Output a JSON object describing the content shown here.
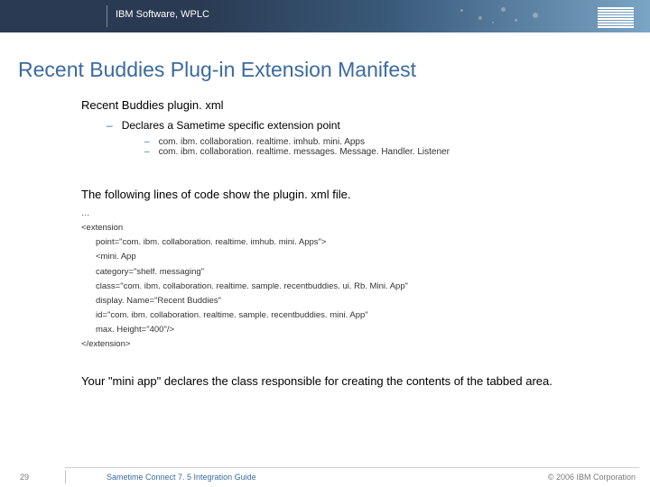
{
  "header": {
    "text": "IBM Software, WPLC",
    "logo_name": "ibm-logo"
  },
  "title": "Recent Buddies Plug-in Extension Manifest",
  "section1": {
    "heading": "Recent Buddies plugin. xml",
    "sub1": "Declares a Sametime specific extension point",
    "pt1": "com. ibm. collaboration. realtime. imhub. mini. Apps",
    "pt2": "com. ibm. collaboration. realtime. messages. Message. Handler. Listener"
  },
  "section2": {
    "heading": "The following lines of code show the plugin. xml file.",
    "code": {
      "l1": "…",
      "l2": "<extension",
      "l3": "point=\"com. ibm. collaboration. realtime. imhub. mini. Apps\">",
      "l4": "<mini. App",
      "l5": "category=\"shelf. messaging\"",
      "l6": "class=\"com. ibm. collaboration. realtime. sample. recentbuddies. ui. Rb. Mini. App\"",
      "l7": "display. Name=\"Recent Buddies\"",
      "l8": "id=\"com. ibm. collaboration. realtime. sample. recentbuddies. mini. App\"",
      "l9": "max. Height=\"400\"/>",
      "l10": "</extension>"
    }
  },
  "section3": {
    "text": "Your \"mini app\" declares the class responsible for creating the contents of the tabbed area."
  },
  "footer": {
    "page": "29",
    "guide": "Sametime Connect 7. 5 Integration Guide",
    "copyright": "© 2006 IBM Corporation"
  }
}
